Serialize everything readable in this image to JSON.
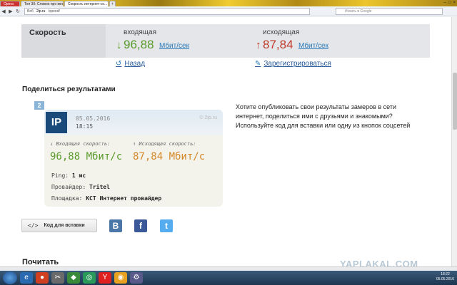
{
  "browser": {
    "tabs": [
      {
        "label": "Opera",
        "active": false
      },
      {
        "label": "Топ 30: Словно про мен...",
        "active": false
      },
      {
        "label": "Скорость интернет-со...",
        "active": true
      },
      {
        "label": "+",
        "active": false
      }
    ],
    "window_controls": {
      "minimize": "–",
      "maximize": "□",
      "close": "×"
    },
    "nav": {
      "back": "◀",
      "forward": "▶",
      "reload": "↻"
    },
    "address_prefix": "Веб",
    "address_host": "2ip.ru",
    "address_path": "/speed/",
    "search_placeholder": "Искать в Google"
  },
  "speed": {
    "label": "Скорость",
    "incoming_title": "входящая",
    "incoming_arrow": "↓",
    "incoming_value": "96,88",
    "incoming_unit": "Мбит/сек",
    "outgoing_title": "исходящая",
    "outgoing_arrow": "↑",
    "outgoing_value": "87,84",
    "outgoing_unit": "Мбит/сек",
    "colors": {
      "incoming": "#5a9a2a",
      "outgoing": "#c0392b",
      "link": "#2a7ab8"
    }
  },
  "links": {
    "back_icon": "↺",
    "back": "Назад",
    "register_icon": "✎",
    "register": "Зарегистрироваться"
  },
  "share": {
    "heading": "Поделиться результатами",
    "description": "Хотите опубликовать свои результаты замеров в сети интернет, поделиться ими с друзьями и знакомыми? Используйте код для вставки или одну из кнопок соцсетей",
    "embed_icon": "</>",
    "embed_button": "Код для вставки",
    "social": {
      "vk": "B",
      "facebook": "f",
      "twitter": "t"
    }
  },
  "card": {
    "badge": "2",
    "logo": "IP",
    "date": "05.05.2016",
    "time": "18:15",
    "brand": "© 2ip.ru",
    "incoming_label": "↓ Входящая скорость:",
    "outgoing_label": "↑ Исходящая скорость:",
    "incoming_value": "96,88 Мбит/с",
    "outgoing_value": "87,84 Мбит/с",
    "ping_label": "Ping:",
    "ping_value": "1 мс",
    "provider_label": "Провайдер:",
    "provider_value": "Tritel",
    "area_label": "Площадка:",
    "area_value": "КСТ Интернет провайдер"
  },
  "read": {
    "heading": "Почитать"
  },
  "watermark": "YAPLAKAL.COM",
  "taskbar": {
    "icons": [
      "e",
      "●",
      "✂",
      "◆",
      "◎",
      "Y",
      "◉",
      "⚙"
    ],
    "time": "18:22",
    "date": "05.05.2016"
  }
}
